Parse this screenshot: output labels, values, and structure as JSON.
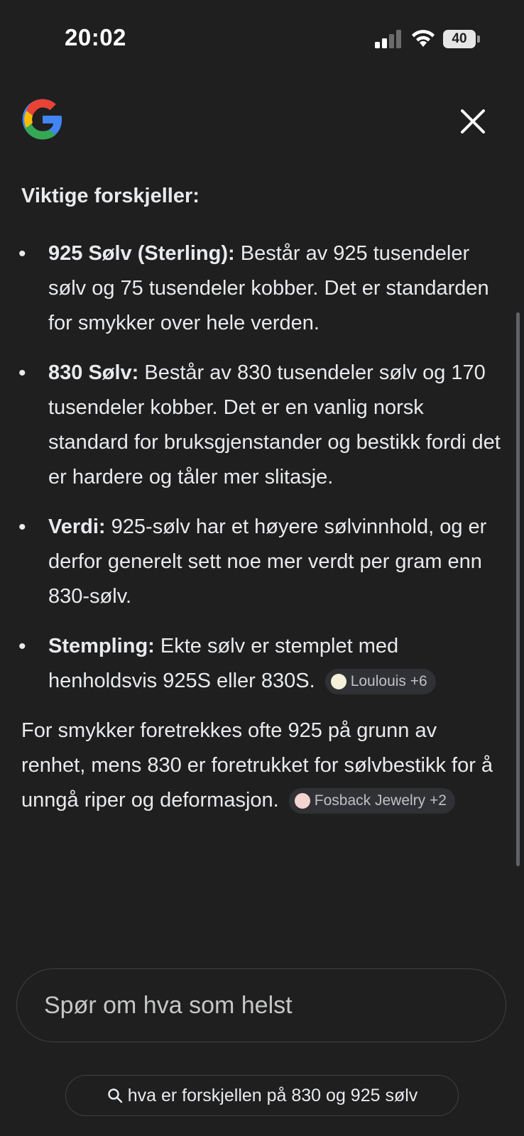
{
  "status_bar": {
    "time": "20:02",
    "battery": "40"
  },
  "content": {
    "heading": "Viktige forskjeller:",
    "points": [
      {
        "label": "925 Sølv (Sterling):",
        "text": " Består av 925 tusendeler sølv og 75 tusendeler kobber. Det er standarden for smykker over hele verden."
      },
      {
        "label": "830 Sølv:",
        "text": " Består av 830 tusendeler sølv og 170 tusendeler kobber. Det er en vanlig norsk standard for bruksgjenstander og bestikk fordi det er hardere og tåler mer slitasje."
      },
      {
        "label": "Verdi:",
        "text": " 925-sølv har et høyere sølvinnhold, og er derfor generelt sett noe mer verdt per gram enn 830-sølv."
      },
      {
        "label": "Stempling:",
        "text": " Ekte sølv er stemplet med henholdsvis 925S eller 830S.",
        "source": "Loulouis +6"
      }
    ],
    "paragraph": "For smykker foretrekkes ofte 925 på grunn av renhet, mens 830 er foretrukket for sølvbestikk for å unngå riper og deformasjon.",
    "paragraph_source": "Fosback Jewelry +2"
  },
  "ask": {
    "placeholder": "Spør om hva som helst"
  },
  "query": {
    "text": "hva er forskjellen på 830 og 925 sølv"
  },
  "colors": {
    "background": "#1f1f1f",
    "text": "#e8eaed",
    "chip": "#303134"
  }
}
